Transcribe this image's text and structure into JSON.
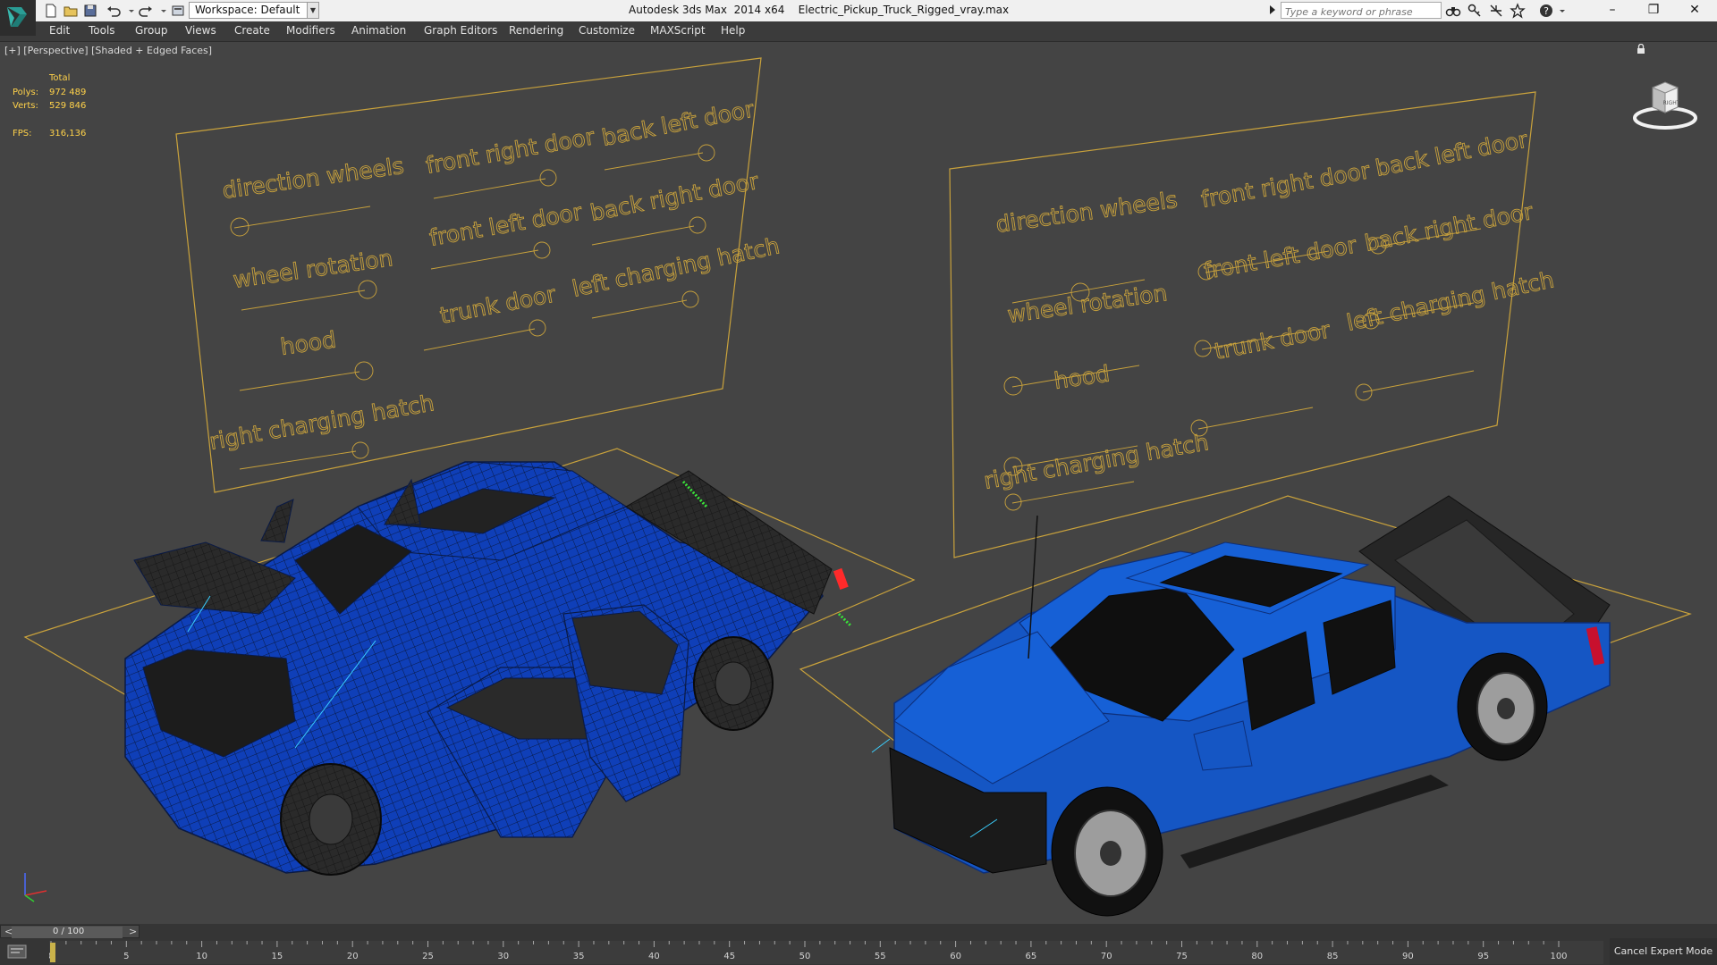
{
  "titlebar": {
    "workspace_label": "Workspace: Default",
    "app_title": "Autodesk 3ds Max  2014 x64",
    "file_name": "Electric_Pickup_Truck_Rigged_vray.max",
    "search_placeholder": "Type a keyword or phrase",
    "window_buttons": [
      "–",
      "❐",
      "✕"
    ]
  },
  "menu": {
    "items": [
      {
        "label": "Edit"
      },
      {
        "label": "Tools"
      },
      {
        "label": "Group"
      },
      {
        "label": "Views"
      },
      {
        "label": "Create"
      },
      {
        "label": "Modifiers"
      },
      {
        "label": "Animation"
      },
      {
        "label": "Graph Editors"
      },
      {
        "label": "Rendering"
      },
      {
        "label": "Customize"
      },
      {
        "label": "MAXScript"
      },
      {
        "label": "Help"
      }
    ]
  },
  "viewport": {
    "label": "[+] [Perspective] [Shaded + Edged Faces]",
    "stats": {
      "total_label": "Total",
      "polys_label": "Polys:",
      "polys_value": "972 489",
      "verts_label": "Verts:",
      "verts_value": "529 846",
      "fps_label": "FPS:",
      "fps_value": "316,136"
    },
    "rig_panel_left": {
      "labels": [
        "direction wheels",
        "front right door",
        "back left door",
        "back right door",
        "wheel rotation",
        "front left door",
        "left charging hatch",
        "hood",
        "trunk door",
        "right charging hatch"
      ]
    },
    "rig_panel_right": {
      "labels": [
        "direction wheels",
        "front right door",
        "back left door",
        "back right door",
        "wheel rotation",
        "front left door",
        "left charging hatch",
        "hood",
        "trunk door",
        "right charging hatch"
      ]
    },
    "viewcube_label": "RIGHT",
    "colors": {
      "rig_gold": "#c9a23c",
      "truck_blue": "#1556c4",
      "wire_blue": "#0d3ab0",
      "background": "#444444"
    }
  },
  "timeline": {
    "frame_counter": "0 / 100",
    "prev": "<",
    "next": ">",
    "current_frame": 0,
    "ticks": [
      "0",
      "5",
      "10",
      "15",
      "20",
      "25",
      "30",
      "35",
      "40",
      "45",
      "50",
      "55",
      "60",
      "65",
      "70",
      "75",
      "80",
      "85",
      "90",
      "95",
      "100"
    ],
    "cancel_expert_label": "Cancel Expert Mode"
  }
}
